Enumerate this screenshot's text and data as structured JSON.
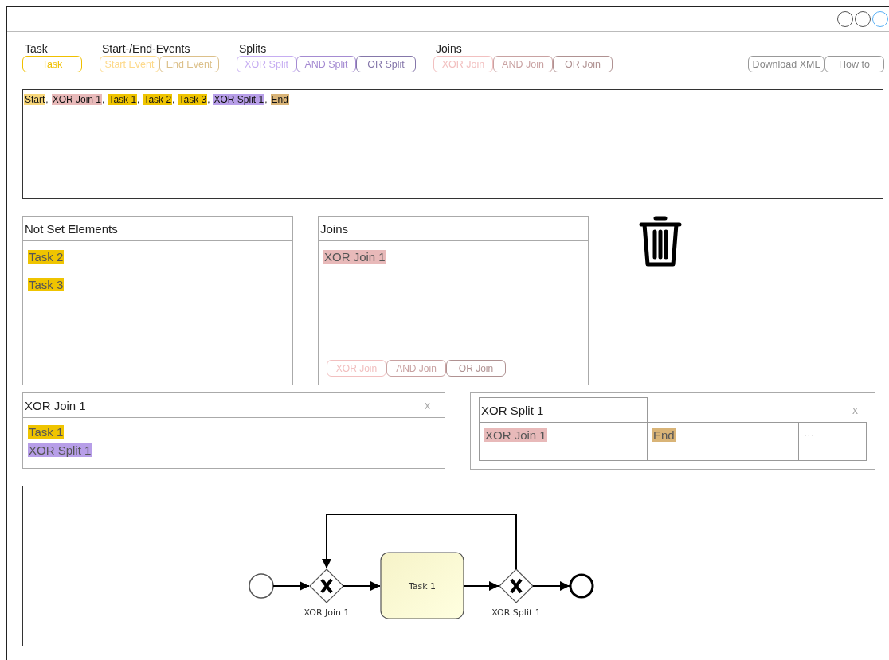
{
  "window_controls": [
    {
      "selected": false
    },
    {
      "selected": false
    },
    {
      "selected": true
    }
  ],
  "palette": [
    {
      "label": "Task",
      "buttons": [
        {
          "label": "Task",
          "color": "#f0c000"
        }
      ]
    },
    {
      "label": "Start-/End-Events",
      "buttons": [
        {
          "label": "Start Event",
          "color": "#fdd98a"
        },
        {
          "label": "End Event",
          "color": "#dcc08a"
        }
      ]
    },
    {
      "label": "Splits",
      "buttons": [
        {
          "label": "XOR Split",
          "color": "#c6adf2"
        },
        {
          "label": "AND Split",
          "color": "#a58bd2"
        },
        {
          "label": "OR Split",
          "color": "#8577aa"
        }
      ]
    },
    {
      "label": "Joins",
      "buttons": [
        {
          "label": "XOR Join",
          "color": "#f2c0c0"
        },
        {
          "label": "AND Join",
          "color": "#c9a2a2"
        },
        {
          "label": "OR Join",
          "color": "#b09292"
        }
      ]
    }
  ],
  "actions": [
    {
      "label": "Download XML"
    },
    {
      "label": "How to"
    }
  ],
  "sequence_separator": ",",
  "sequence": [
    {
      "label": "Start",
      "color": "#f7d67a"
    },
    {
      "label": "XOR Join 1",
      "color": "#e8b9b9"
    },
    {
      "label": "Task 1",
      "color": "#efc400"
    },
    {
      "label": "Task 2",
      "color": "#efc400"
    },
    {
      "label": "Task 3",
      "color": "#efc400"
    },
    {
      "label": "XOR Split 1",
      "color": "#b79ee8"
    },
    {
      "label": "End",
      "color": "#d9b477"
    }
  ],
  "not_set_panel": {
    "title": "Not Set Elements",
    "items": [
      {
        "label": "Task 2",
        "color": "#efc400"
      },
      {
        "label": "Task 3",
        "color": "#efc400"
      }
    ]
  },
  "joins_panel": {
    "title": "Joins",
    "items": [
      {
        "label": "XOR Join 1",
        "color": "#e8b9b9"
      }
    ],
    "buttons": [
      {
        "label": "XOR Join",
        "color": "#f2c0c0"
      },
      {
        "label": "AND Join",
        "color": "#c9a2a2"
      },
      {
        "label": "OR Join",
        "color": "#b09292"
      }
    ]
  },
  "join_detail": {
    "title": "XOR Join 1",
    "close": "x",
    "items": [
      {
        "label": "Task 1",
        "color": "#efc400"
      },
      {
        "label": "XOR Split 1",
        "color": "#b79ee8"
      }
    ]
  },
  "split_detail": {
    "title": "XOR Split 1",
    "close": "x",
    "targets": [
      {
        "label": "XOR Join 1",
        "color": "#e8b9b9"
      },
      {
        "label": "End",
        "color": "#d9b477"
      }
    ],
    "more": "···"
  },
  "diagram": {
    "task": "Task 1",
    "join_label": "XOR Join 1",
    "split_label": "XOR Split 1"
  }
}
